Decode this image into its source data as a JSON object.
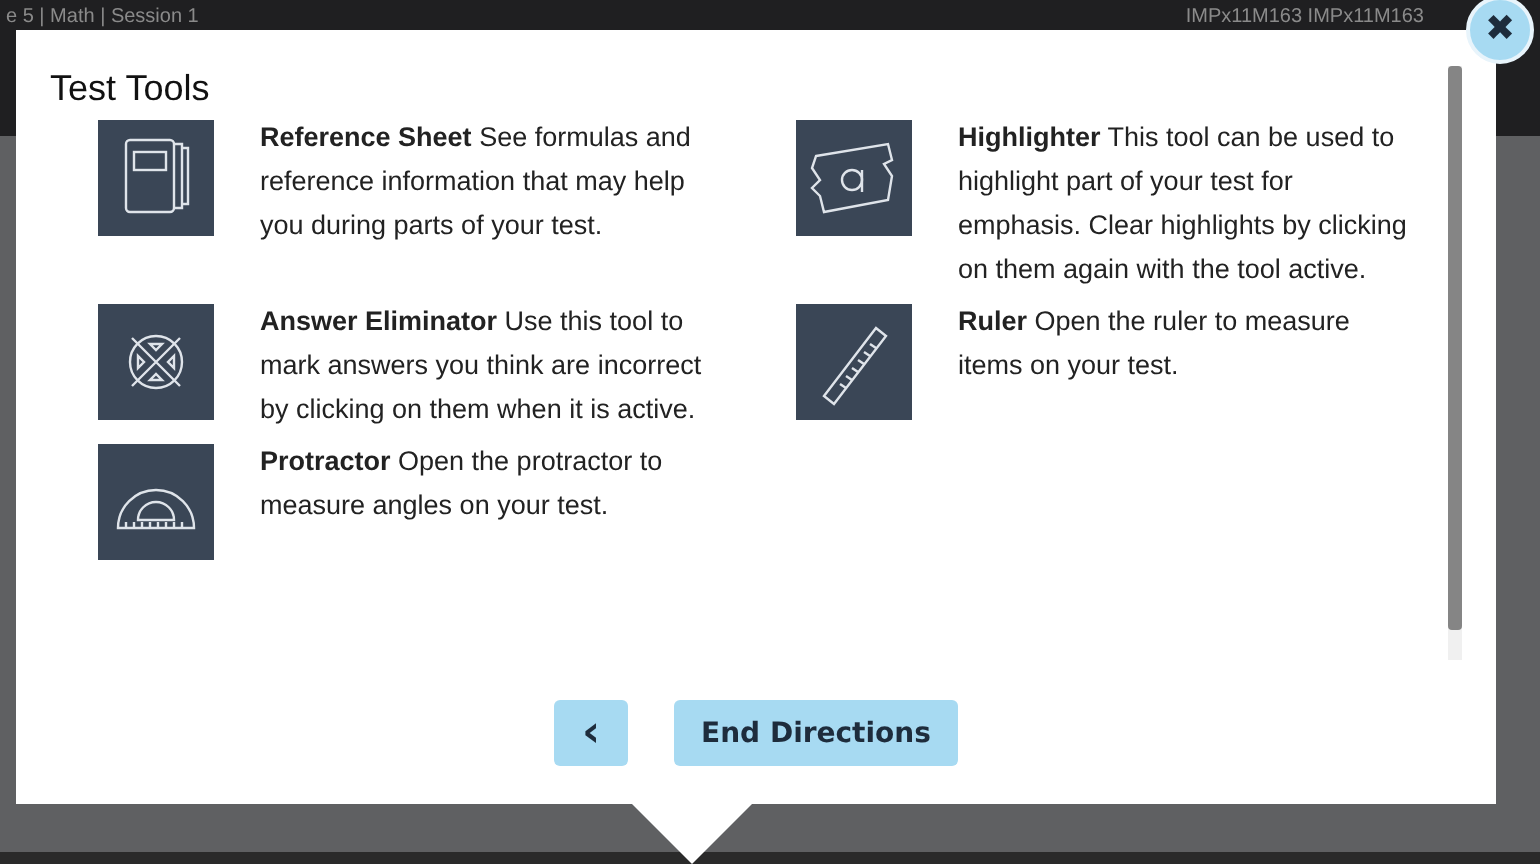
{
  "header": {
    "left": "e 5 | Math | Session 1",
    "right": "IMPx11M163 IMPx11M163"
  },
  "dialog": {
    "title": "Test Tools",
    "close": "✖",
    "tools": [
      {
        "kind": "book",
        "text": "**Reference Sheet** See formulas and reference information that may help you during parts of your test."
      },
      {
        "kind": "highlighter",
        "text": "**Highlighter** This tool can be used to highlight part of your test for emphasis. Clear highlights by clicking on them again with the tool active."
      },
      {
        "kind": "eliminator",
        "text": "**Answer Eliminator** Use this tool to mark answers you think are incorrect by clicking on them when it is active."
      },
      {
        "kind": "ruler",
        "text": "**Ruler** Open the ruler to measure items on your test."
      },
      {
        "kind": "protractor",
        "text": "**Protractor** Open the protractor to measure angles on your test."
      }
    ],
    "back": "‹",
    "end": "End Directions"
  }
}
